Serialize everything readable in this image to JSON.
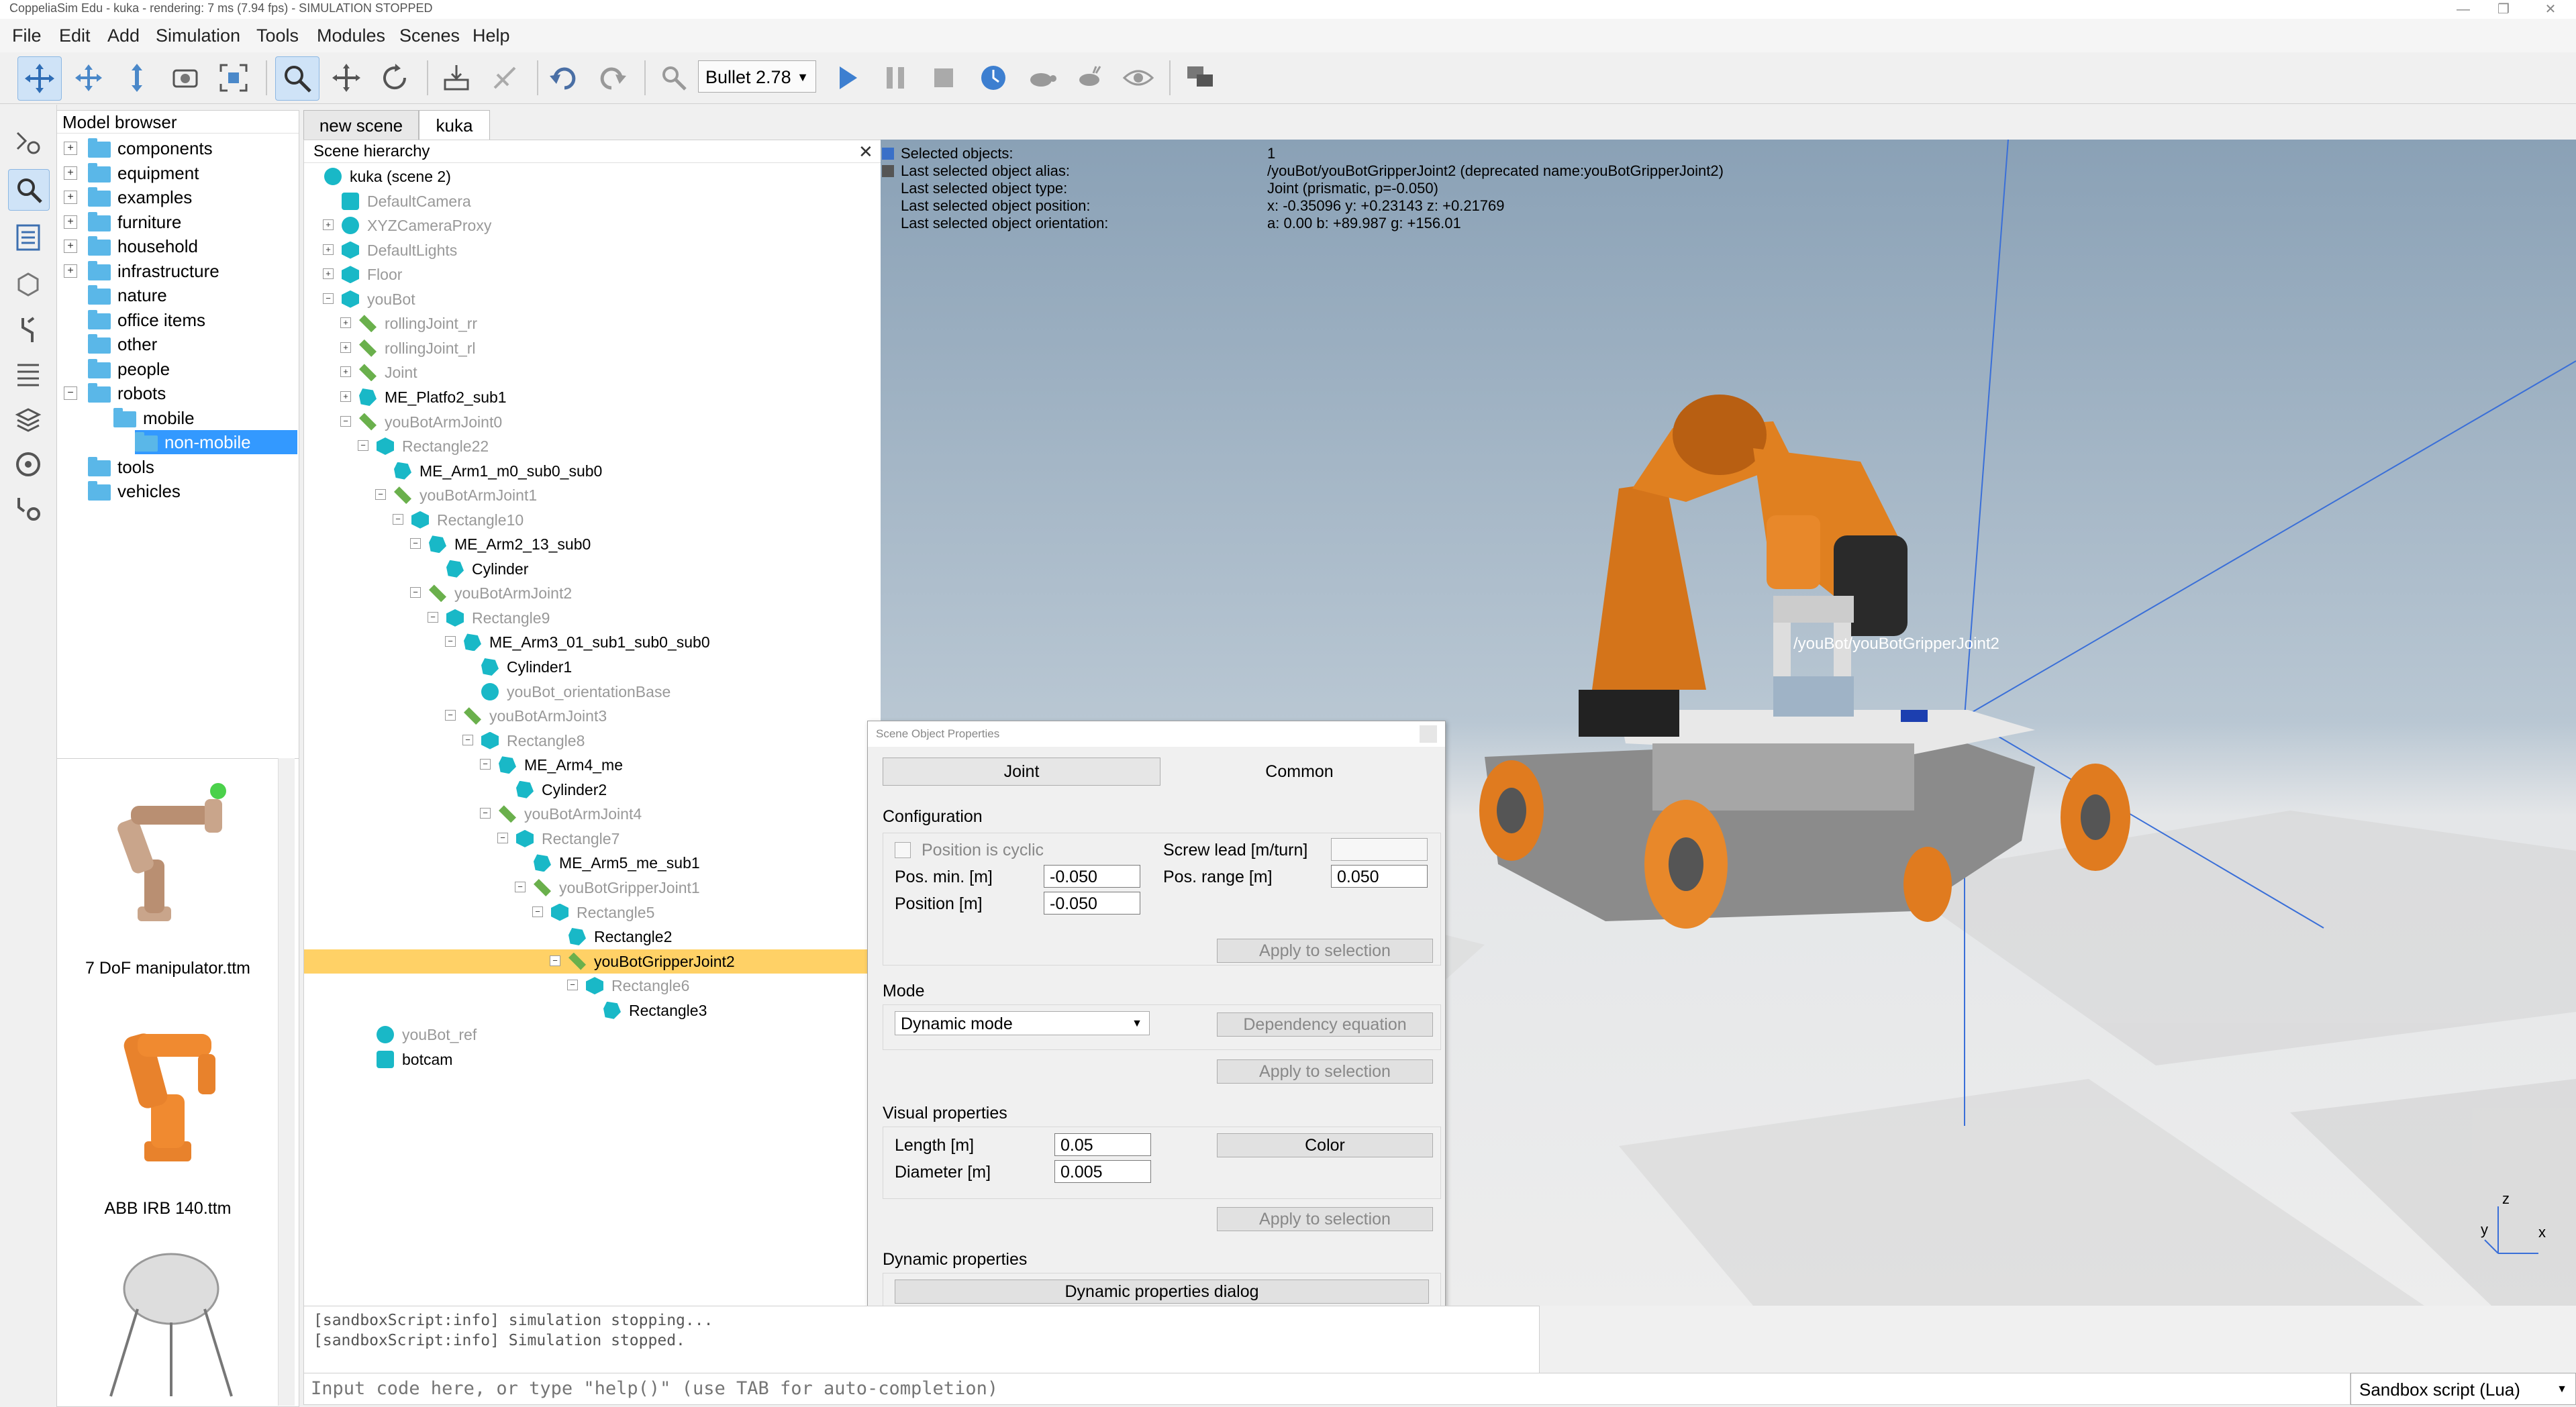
{
  "window": {
    "title": "CoppeliaSim Edu - kuka - rendering: 7 ms (7.94 fps) - SIMULATION STOPPED",
    "controls": [
      "—",
      "❐",
      "✕"
    ]
  },
  "menu": [
    "File",
    "Edit",
    "Add",
    "Simulation",
    "Tools",
    "Modules",
    "Scenes",
    "Help"
  ],
  "toolbar": {
    "engine": "Bullet 2.78",
    "buttons": [
      "camera-pan-icon",
      "camera-rotate-icon",
      "camera-shift-icon",
      "camera-angle-icon",
      "fit-to-view-icon",
      "selection-icon",
      "object-shift-icon",
      "object-rotate-icon",
      "assemble-icon",
      "transfer-dna-icon",
      "undo-icon",
      "redo-icon",
      "dynamic-content-icon",
      "play-icon",
      "pause-icon",
      "stop-icon",
      "real-time-icon",
      "slow-down-icon",
      "speed-up-icon",
      "visualization-icon",
      "page-selector-icon"
    ]
  },
  "model_browser": {
    "header": "Model browser",
    "items": [
      {
        "label": "components",
        "level": 0,
        "expand": "+"
      },
      {
        "label": "equipment",
        "level": 0,
        "expand": "+"
      },
      {
        "label": "examples",
        "level": 0,
        "expand": "+"
      },
      {
        "label": "furniture",
        "level": 0,
        "expand": "+"
      },
      {
        "label": "household",
        "level": 0,
        "expand": "+"
      },
      {
        "label": "infrastructure",
        "level": 0,
        "expand": "+"
      },
      {
        "label": "nature",
        "level": 0,
        "expand": ""
      },
      {
        "label": "office items",
        "level": 0,
        "expand": ""
      },
      {
        "label": "other",
        "level": 0,
        "expand": ""
      },
      {
        "label": "people",
        "level": 0,
        "expand": ""
      },
      {
        "label": "robots",
        "level": 0,
        "expand": "−"
      },
      {
        "label": "mobile",
        "level": 1,
        "expand": ""
      },
      {
        "label": "non-mobile",
        "level": 1,
        "expand": "",
        "selected": true
      },
      {
        "label": "tools",
        "level": 0,
        "expand": ""
      },
      {
        "label": "vehicles",
        "level": 0,
        "expand": ""
      }
    ],
    "thumbnails": [
      "7 DoF manipulator.ttm",
      "ABB IRB 140.ttm"
    ]
  },
  "tabs": [
    "new scene",
    "kuka"
  ],
  "hierarchy": {
    "header": "Scene hierarchy",
    "close": "✕",
    "rows": [
      {
        "label": "kuka (scene 2)",
        "indent": 0,
        "icon": "dummy",
        "expand": "",
        "dim": false
      },
      {
        "label": "DefaultCamera",
        "indent": 1,
        "icon": "cam",
        "expand": "",
        "dim": true
      },
      {
        "label": "XYZCameraProxy",
        "indent": 1,
        "icon": "dummy",
        "expand": "+",
        "dim": true
      },
      {
        "label": "DefaultLights",
        "indent": 1,
        "icon": "shape",
        "expand": "+",
        "dim": true
      },
      {
        "label": "Floor",
        "indent": 1,
        "icon": "shape",
        "expand": "+",
        "dim": true
      },
      {
        "label": "youBot",
        "indent": 1,
        "icon": "shape",
        "expand": "−",
        "dim": true
      },
      {
        "label": "rollingJoint_rr",
        "indent": 2,
        "icon": "joint",
        "expand": "+",
        "dim": true
      },
      {
        "label": "rollingJoint_rl",
        "indent": 2,
        "icon": "joint",
        "expand": "+",
        "dim": true
      },
      {
        "label": "Joint",
        "indent": 2,
        "icon": "joint",
        "expand": "+",
        "dim": true
      },
      {
        "label": "ME_Platfo2_sub1",
        "indent": 2,
        "icon": "mesh",
        "expand": "+",
        "dim": false
      },
      {
        "label": "youBotArmJoint0",
        "indent": 2,
        "icon": "joint",
        "expand": "−",
        "dim": true
      },
      {
        "label": "Rectangle22",
        "indent": 3,
        "icon": "shape",
        "expand": "−",
        "dim": true
      },
      {
        "label": "ME_Arm1_m0_sub0_sub0",
        "indent": 4,
        "icon": "mesh",
        "expand": "",
        "dim": false
      },
      {
        "label": "youBotArmJoint1",
        "indent": 4,
        "icon": "joint",
        "expand": "−",
        "dim": true
      },
      {
        "label": "Rectangle10",
        "indent": 5,
        "icon": "shape",
        "expand": "−",
        "dim": true
      },
      {
        "label": "ME_Arm2_13_sub0",
        "indent": 6,
        "icon": "mesh",
        "expand": "−",
        "dim": false
      },
      {
        "label": "Cylinder",
        "indent": 7,
        "icon": "mesh",
        "expand": "",
        "dim": false
      },
      {
        "label": "youBotArmJoint2",
        "indent": 6,
        "icon": "joint",
        "expand": "−",
        "dim": true
      },
      {
        "label": "Rectangle9",
        "indent": 7,
        "icon": "shape",
        "expand": "−",
        "dim": true
      },
      {
        "label": "ME_Arm3_01_sub1_sub0_sub0",
        "indent": 8,
        "icon": "mesh",
        "expand": "−",
        "dim": false
      },
      {
        "label": "Cylinder1",
        "indent": 9,
        "icon": "mesh",
        "expand": "",
        "dim": false
      },
      {
        "label": "youBot_orientationBase",
        "indent": 9,
        "icon": "dummy",
        "expand": "",
        "dim": true
      },
      {
        "label": "youBotArmJoint3",
        "indent": 8,
        "icon": "joint",
        "expand": "−",
        "dim": true
      },
      {
        "label": "Rectangle8",
        "indent": 9,
        "icon": "shape",
        "expand": "−",
        "dim": true
      },
      {
        "label": "ME_Arm4_me",
        "indent": 10,
        "icon": "mesh",
        "expand": "−",
        "dim": false
      },
      {
        "label": "Cylinder2",
        "indent": 11,
        "icon": "mesh",
        "expand": "",
        "dim": false
      },
      {
        "label": "youBotArmJoint4",
        "indent": 10,
        "icon": "joint",
        "expand": "−",
        "dim": true
      },
      {
        "label": "Rectangle7",
        "indent": 11,
        "icon": "shape",
        "expand": "−",
        "dim": true
      },
      {
        "label": "ME_Arm5_me_sub1",
        "indent": 12,
        "icon": "mesh",
        "expand": "",
        "dim": false
      },
      {
        "label": "youBotGripperJoint1",
        "indent": 12,
        "icon": "joint",
        "expand": "−",
        "dim": true
      },
      {
        "label": "Rectangle5",
        "indent": 13,
        "icon": "shape",
        "expand": "−",
        "dim": true
      },
      {
        "label": "Rectangle2",
        "indent": 14,
        "icon": "mesh",
        "expand": "",
        "dim": false
      },
      {
        "label": "youBotGripperJoint2",
        "indent": 14,
        "icon": "joint",
        "expand": "−",
        "dim": false,
        "selected": true
      },
      {
        "label": "Rectangle6",
        "indent": 15,
        "icon": "shape",
        "expand": "−",
        "dim": true
      },
      {
        "label": "Rectangle3",
        "indent": 16,
        "icon": "mesh",
        "expand": "",
        "dim": false
      },
      {
        "label": "youBot_ref",
        "indent": 3,
        "icon": "dummy",
        "expand": "",
        "dim": true
      },
      {
        "label": "botcam",
        "indent": 3,
        "icon": "cam",
        "expand": "",
        "dim": false
      }
    ]
  },
  "info": {
    "rows": [
      {
        "k": "Selected objects:",
        "v": "1"
      },
      {
        "k": "Last selected object alias:",
        "v": "/youBot/youBotGripperJoint2    (deprecated name:youBotGripperJoint2)"
      },
      {
        "k": "Last selected object type:",
        "v": "Joint (prismatic, p=-0.050)"
      },
      {
        "k": "Last selected object position:",
        "v": "x: -0.35096    y: +0.23143    z: +0.21769"
      },
      {
        "k": "Last selected object orientation:",
        "v": "a: 0.00    b: +89.987    g: +156.01"
      }
    ]
  },
  "viewport": {
    "object_label": "/youBot/youBotGripperJoint2",
    "axes": {
      "x": "x",
      "y": "y",
      "z": "z"
    }
  },
  "dialog": {
    "title": "Scene Object Properties",
    "tab_joint": "Joint",
    "tab_common": "Common",
    "configuration": "Configuration",
    "position_cyclic": "Position is cyclic",
    "screw_lead_label": "Screw lead [m/turn]",
    "screw_lead_value": "",
    "pos_min_label": "Pos. min. [m]",
    "pos_min_value": "-0.050",
    "pos_range_label": "Pos. range [m]",
    "pos_range_value": "0.050",
    "position_label": "Position [m]",
    "position_value": "-0.050",
    "apply1": "Apply to selection",
    "mode": "Mode",
    "mode_value": "Dynamic mode",
    "dependency": "Dependency equation",
    "apply2": "Apply to selection",
    "visual": "Visual properties",
    "length_label": "Length [m]",
    "length_value": "0.05",
    "diameter_label": "Diameter [m]",
    "diameter_value": "0.005",
    "color": "Color",
    "apply3": "Apply to selection",
    "dynamic": "Dynamic properties",
    "dynamic_dialog": "Dynamic properties dialog"
  },
  "console": {
    "lines": [
      "[sandboxScript:info] simulation stopping...",
      "[sandboxScript:info] Simulation stopped."
    ],
    "placeholder": "Input code here, or type \"help()\" (use TAB for auto-completion)",
    "script_select": "Sandbox script (Lua)"
  },
  "colors": {
    "accent": "#3399ff",
    "selection": "#ffd166",
    "robot": "#e07b1f",
    "panel_bg": "#f0f0f0"
  }
}
